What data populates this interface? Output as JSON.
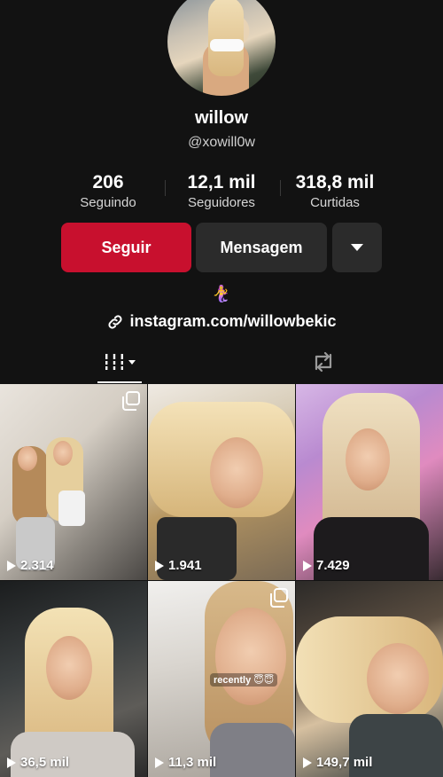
{
  "profile": {
    "name": "willow",
    "handle": "@xowill0w",
    "stats": [
      {
        "value": "206",
        "label": "Seguindo"
      },
      {
        "value": "12,1 mil",
        "label": "Seguidores"
      },
      {
        "value": "318,8 mil",
        "label": "Curtidas"
      }
    ],
    "bio_emoji": "🧜‍♀️",
    "link": "instagram.com/willowbekic"
  },
  "actions": {
    "follow_label": "Seguir",
    "message_label": "Mensagem"
  },
  "icons": {
    "more": "chevron-down-icon",
    "link": "link-icon",
    "videos_tab": "grid-icon",
    "reposts_tab": "repost-icon",
    "play": "play-icon",
    "multi": "photo-carousel-icon"
  },
  "colors": {
    "background": "#121212",
    "follow": "#c8102e",
    "secondary_button": "#2b2b2b"
  },
  "videos": [
    {
      "views": "2.314",
      "multi": true
    },
    {
      "views": "1.941",
      "multi": false
    },
    {
      "views": "7.429",
      "multi": false
    },
    {
      "views": "36,5 mil",
      "multi": false
    },
    {
      "views": "11,3 mil",
      "multi": true,
      "sticker": "recently 😇😇"
    },
    {
      "views": "149,7 mil",
      "multi": false
    }
  ]
}
